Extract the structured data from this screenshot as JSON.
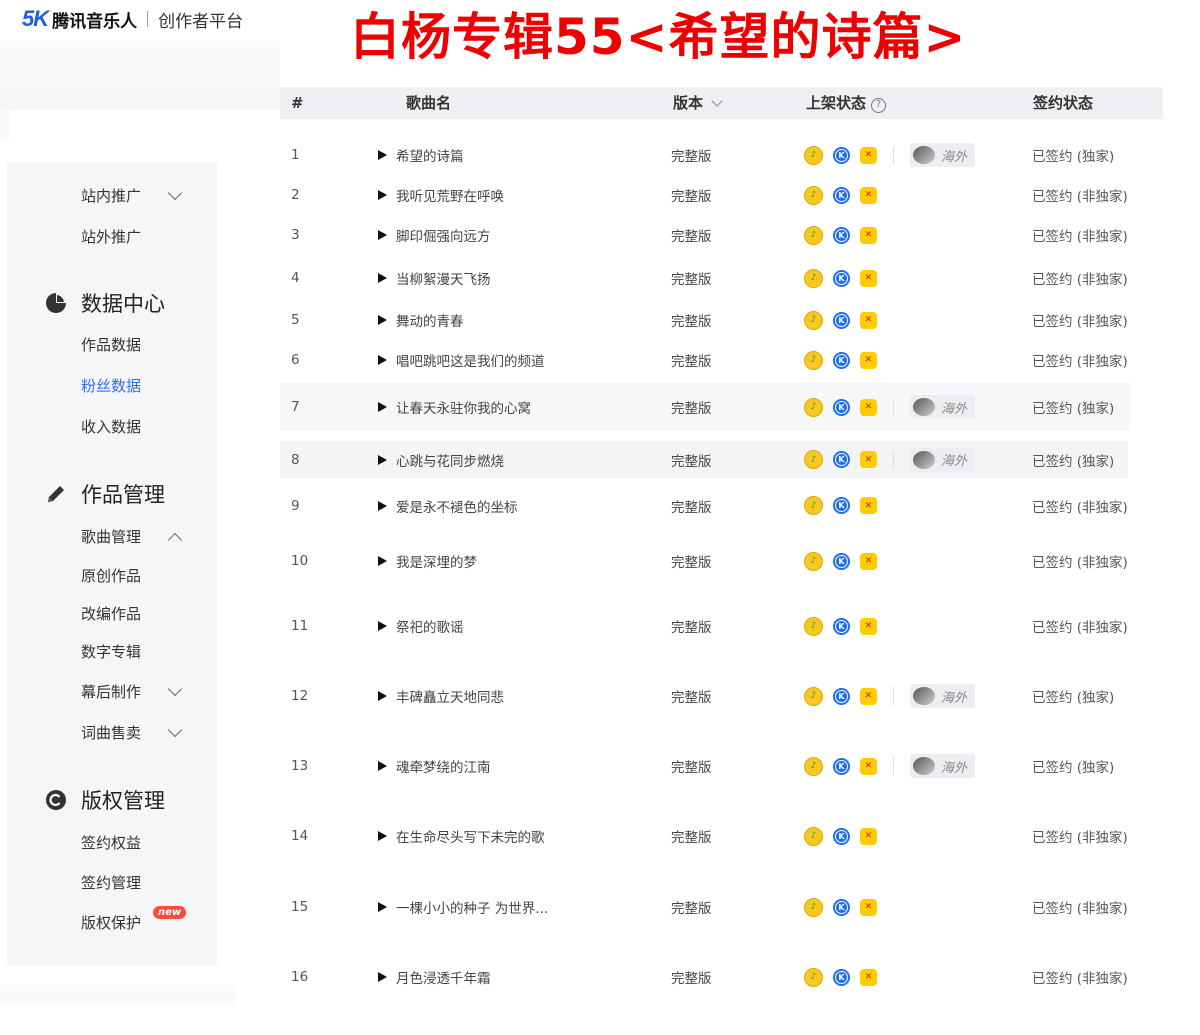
{
  "header": {
    "logo_mark": "5K",
    "logo_text": "腾讯音乐人",
    "logo_sub": "创作者平台",
    "banner_title": "白杨专辑55<希望的诗篇>"
  },
  "sidebar": {
    "items": [
      {
        "label": "站内推广",
        "chevron": "down"
      },
      {
        "label": "站外推广"
      }
    ],
    "sections": [
      {
        "label": "数据中心",
        "icon": "pie-chart-icon",
        "items": [
          {
            "label": "作品数据"
          },
          {
            "label": "粉丝数据",
            "active": true
          },
          {
            "label": "收入数据"
          }
        ]
      },
      {
        "label": "作品管理",
        "icon": "pencil-icon",
        "items": [
          {
            "label": "歌曲管理",
            "chevron": "up"
          },
          {
            "label": "原创作品"
          },
          {
            "label": "改编作品"
          },
          {
            "label": "数字专辑"
          },
          {
            "label": "幕后制作",
            "chevron": "down"
          },
          {
            "label": "词曲售卖",
            "chevron": "down"
          }
        ]
      },
      {
        "label": "版权管理",
        "icon": "copyright-icon",
        "items": [
          {
            "label": "签约权益"
          },
          {
            "label": "签约管理"
          },
          {
            "label": "版权保护"
          }
        ]
      }
    ],
    "new_badge": "new",
    "accent_color": "#2f6bff"
  },
  "table": {
    "columns": {
      "index": "#",
      "name": "歌曲名",
      "version": "版本",
      "status": "上架状态",
      "sign": "签约状态"
    },
    "help_glyph": "?",
    "overseas_label": "海外",
    "platform_icons": [
      "qq-music-icon",
      "kugou-icon",
      "kuwo-icon"
    ],
    "rows": [
      {
        "index": "1",
        "name": "希望的诗篇",
        "version": "完整版",
        "overseas": true,
        "sign": "已签约 (独家)"
      },
      {
        "index": "2",
        "name": "我听见荒野在呼唤",
        "version": "完整版",
        "overseas": false,
        "sign": "已签约 (非独家)"
      },
      {
        "index": "3",
        "name": "脚印倔强向远方",
        "version": "完整版",
        "overseas": false,
        "sign": "已签约 (非独家)"
      },
      {
        "index": "4",
        "name": "当柳絮漫天飞扬",
        "version": "完整版",
        "overseas": false,
        "sign": "已签约 (非独家)"
      },
      {
        "index": "5",
        "name": "舞动的青春",
        "version": "完整版",
        "overseas": false,
        "sign": "已签约 (非独家)"
      },
      {
        "index": "6",
        "name": "唱吧跳吧这是我们的频道",
        "version": "完整版",
        "overseas": false,
        "sign": "已签约 (非独家)"
      },
      {
        "index": "7",
        "name": "让春天永驻你我的心窝",
        "version": "完整版",
        "overseas": true,
        "sign": "已签约 (独家)"
      },
      {
        "index": "8",
        "name": "心跳与花同步燃烧",
        "version": "完整版",
        "overseas": true,
        "sign": "已签约 (独家)"
      },
      {
        "index": "9",
        "name": "爱是永不褪色的坐标",
        "version": "完整版",
        "overseas": false,
        "sign": "已签约 (非独家)"
      },
      {
        "index": "10",
        "name": "我是深埋的梦",
        "version": "完整版",
        "overseas": false,
        "sign": "已签约 (非独家)"
      },
      {
        "index": "11",
        "name": "祭祀的歌谣",
        "version": "完整版",
        "overseas": false,
        "sign": "已签约 (非独家)"
      },
      {
        "index": "12",
        "name": "丰碑矗立天地同悲",
        "version": "完整版",
        "overseas": true,
        "sign": "已签约 (独家)"
      },
      {
        "index": "13",
        "name": "魂牵梦绕的江南",
        "version": "完整版",
        "overseas": true,
        "sign": "已签约 (独家)"
      },
      {
        "index": "14",
        "name": "在生命尽头写下未完的歌",
        "version": "完整版",
        "overseas": false,
        "sign": "已签约 (非独家)"
      },
      {
        "index": "15",
        "name": "一棵小小的种子 为世界...",
        "version": "完整版",
        "overseas": false,
        "sign": "已签约 (非独家)"
      },
      {
        "index": "16",
        "name": "月色浸透千年霜",
        "version": "完整版",
        "overseas": false,
        "sign": "已签约 (非独家)"
      }
    ]
  }
}
